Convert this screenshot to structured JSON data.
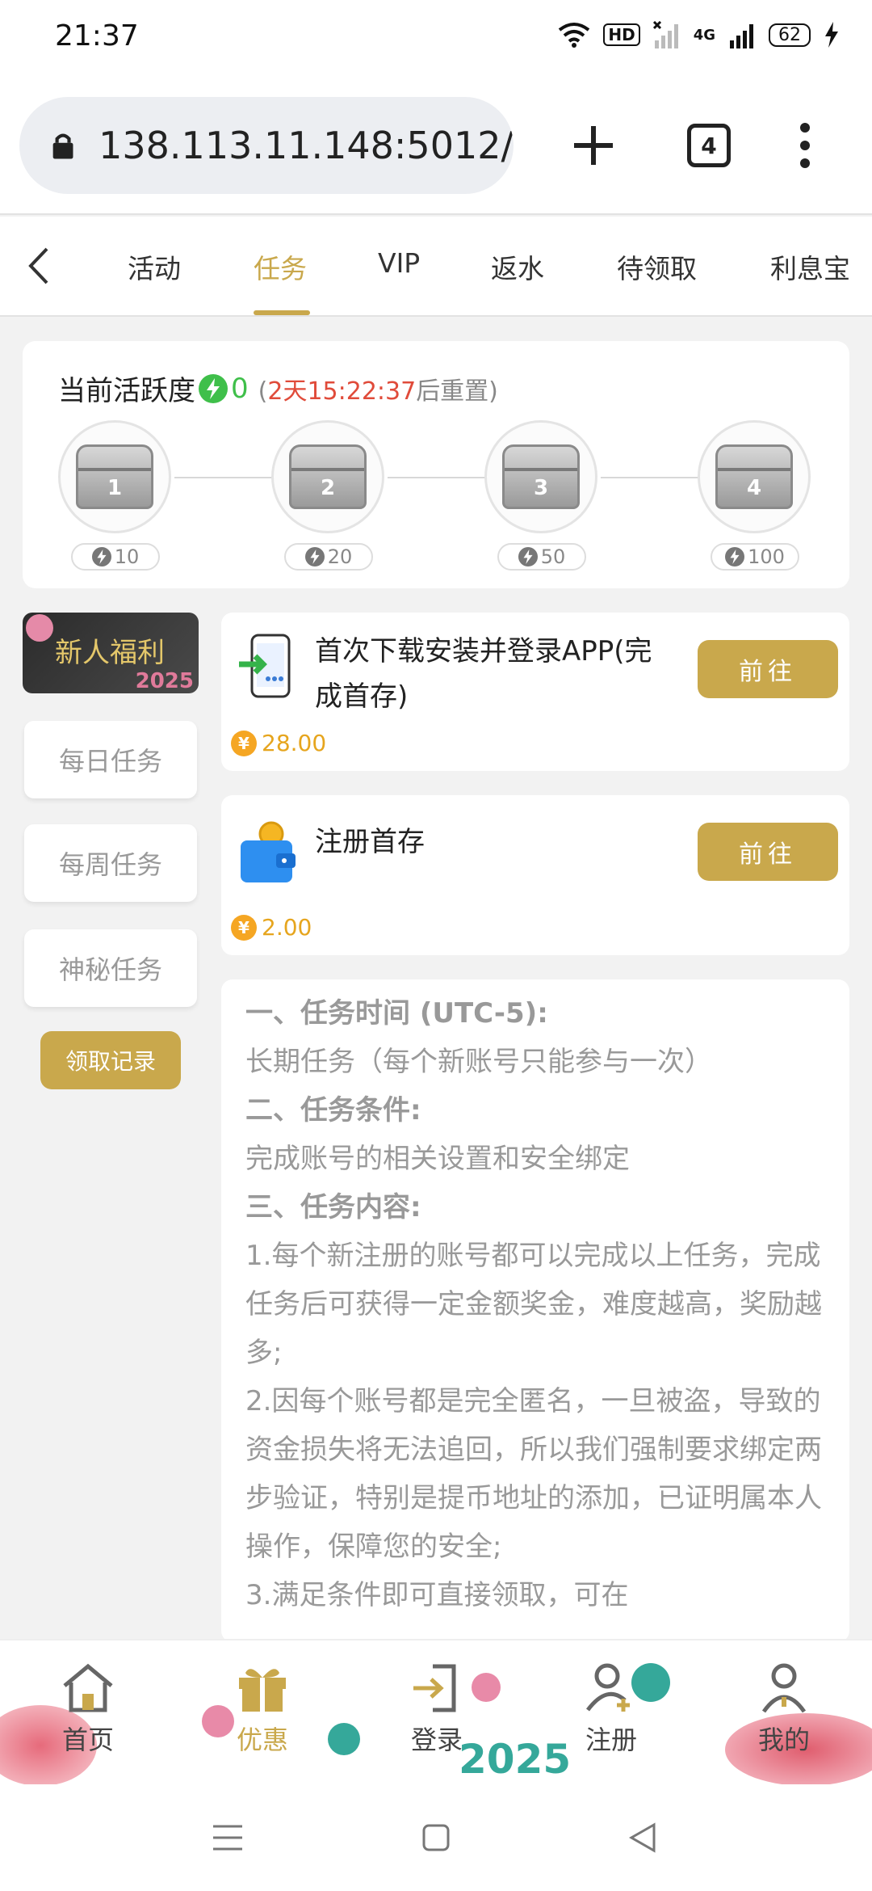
{
  "status_bar": {
    "time": "21:37",
    "network": "4G",
    "hd": "HD",
    "battery": "62"
  },
  "browser": {
    "url": "138.113.11.148:5012/",
    "tab_count": "4"
  },
  "tabs": [
    {
      "label": "活动"
    },
    {
      "label": "任务",
      "active": true
    },
    {
      "label": "VIP"
    },
    {
      "label": "返水"
    },
    {
      "label": "待领取"
    },
    {
      "label": "利息宝"
    }
  ],
  "activity": {
    "title": "当前活跃度",
    "points": "0",
    "reset_open": "(",
    "reset_time": "2天15:22:37",
    "reset_suffix": "后重置)",
    "chests": [
      {
        "num": "1",
        "req": "10"
      },
      {
        "num": "2",
        "req": "20"
      },
      {
        "num": "3",
        "req": "50"
      },
      {
        "num": "4",
        "req": "100"
      }
    ]
  },
  "sidebar": {
    "banner_label": "新人福利",
    "banner_year": "2025",
    "items": [
      "每日任务",
      "每周任务",
      "神秘任务"
    ],
    "record_button": "领取记录"
  },
  "tasks": [
    {
      "name": "首次下载安装并登录APP(完成首存)",
      "button": "前往",
      "reward": "28.00",
      "icon": "phone-download-icon"
    },
    {
      "name": "注册首存",
      "button": "前往",
      "reward": "2.00",
      "icon": "wallet-icon"
    }
  ],
  "rules": [
    {
      "type": "h",
      "text": "一、任务时间 (UTC-5):"
    },
    {
      "type": "b",
      "text": "长期任务（每个新账号只能参与一次）"
    },
    {
      "type": "h",
      "text": "二、任务条件:"
    },
    {
      "type": "b",
      "text": "完成账号的相关设置和安全绑定"
    },
    {
      "type": "h",
      "text": "三、任务内容:"
    },
    {
      "type": "b",
      "text": "1.每个新注册的账号都可以完成以上任务，完成任务后可获得一定金额奖金，难度越高，奖励越多;"
    },
    {
      "type": "b",
      "text": "2.因每个账号都是完全匿名，一旦被盗，导致的资金损失将无法追回，所以我们强制要求绑定两步验证，特别是提币地址的添加，已证明属本人操作，保障您的安全;"
    },
    {
      "type": "b",
      "text": "3.满足条件即可直接领取，可在"
    }
  ],
  "bottom_nav": [
    {
      "label": "首页",
      "icon": "home-icon"
    },
    {
      "label": "优惠",
      "icon": "gift-icon",
      "active": true
    },
    {
      "label": "登录",
      "icon": "login-icon"
    },
    {
      "label": "注册",
      "icon": "register-icon"
    },
    {
      "label": "我的",
      "icon": "profile-icon"
    }
  ],
  "bottom_year": "2025",
  "colors": {
    "accent": "#c9a84c",
    "green": "#3fbf4a",
    "red": "#e04b3a",
    "coin": "#f5a623"
  }
}
